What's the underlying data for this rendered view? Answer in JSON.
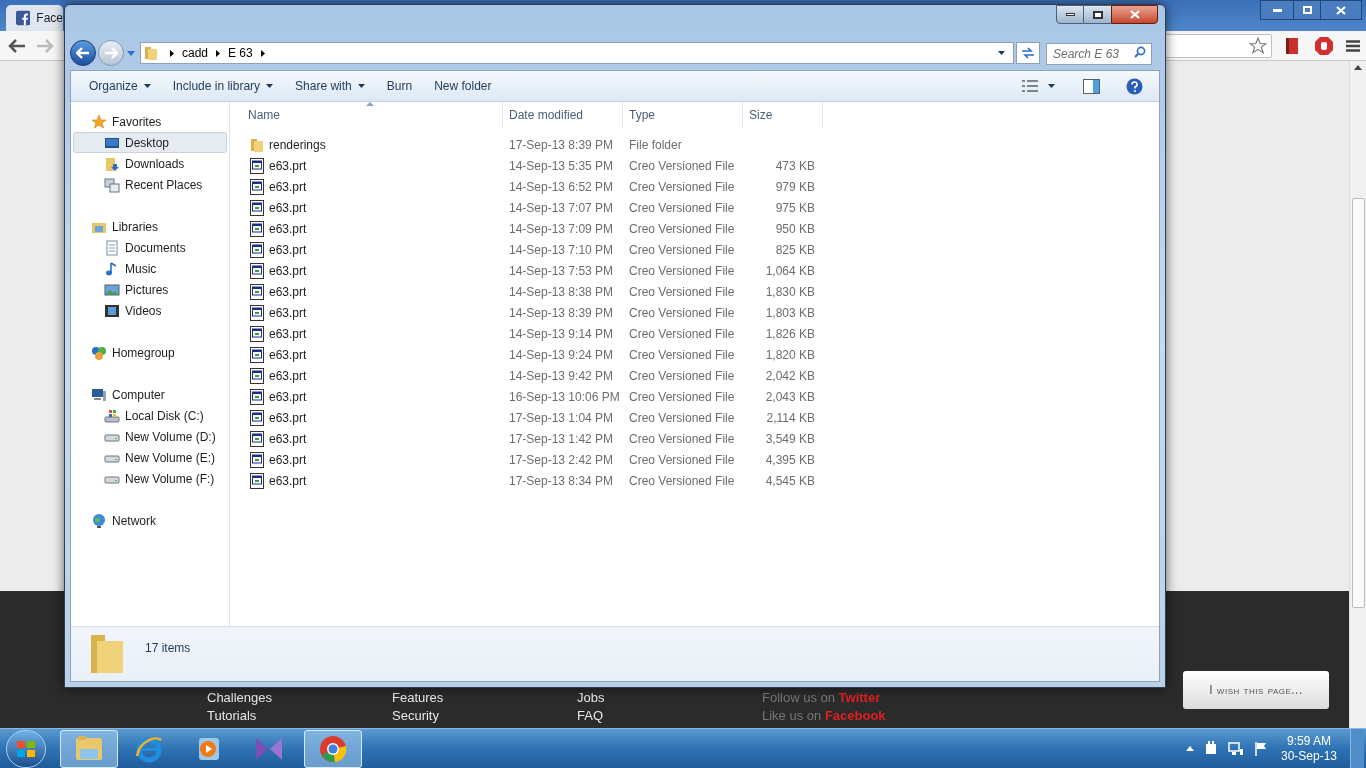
{
  "browser": {
    "tabs": [
      {
        "title": "Face",
        "selected": false
      }
    ],
    "footer": {
      "links": [
        [
          "Challenges",
          "Tutorials"
        ],
        [
          "Features",
          "Security"
        ],
        [
          "Jobs",
          "FAQ"
        ]
      ],
      "social": [
        "Follow us on **Twitter**",
        "Like us on **Facebook**"
      ],
      "feedback_button": "I wish this page..."
    }
  },
  "explorer": {
    "breadcrumb": [
      "cadd",
      "E 63"
    ],
    "search": {
      "placeholder": "Search E 63"
    },
    "toolbar": [
      {
        "label": "Organize",
        "dropdown": true
      },
      {
        "label": "Include in library",
        "dropdown": true
      },
      {
        "label": "Share with",
        "dropdown": true
      },
      {
        "label": "Burn",
        "dropdown": false
      },
      {
        "label": "New folder",
        "dropdown": false
      }
    ],
    "nav": [
      {
        "label": "Favorites",
        "kind": "star",
        "children": [
          {
            "label": "Desktop",
            "kind": "desktop",
            "selected": true
          },
          {
            "label": "Downloads",
            "kind": "downloads",
            "selected": false
          },
          {
            "label": "Recent Places",
            "kind": "recent",
            "selected": false
          }
        ]
      },
      {
        "label": "Libraries",
        "kind": "library",
        "children": [
          {
            "label": "Documents",
            "kind": "document",
            "selected": false
          },
          {
            "label": "Music",
            "kind": "music",
            "selected": false
          },
          {
            "label": "Pictures",
            "kind": "pictures",
            "selected": false
          },
          {
            "label": "Videos",
            "kind": "videos",
            "selected": false
          }
        ]
      },
      {
        "label": "Homegroup",
        "kind": "homegroup"
      },
      {
        "label": "Computer",
        "kind": "computer",
        "children": [
          {
            "label": "Local Disk (C:)",
            "kind": "disk",
            "selected": false
          },
          {
            "label": "New Volume (D:)",
            "kind": "drive",
            "selected": false
          },
          {
            "label": "New Volume (E:)",
            "kind": "drive",
            "selected": false
          },
          {
            "label": "New Volume (F:)",
            "kind": "drive",
            "selected": false
          }
        ]
      },
      {
        "label": "Network",
        "kind": "network"
      }
    ],
    "columns": [
      {
        "label": "Name",
        "sorted": true
      },
      {
        "label": "Date modified",
        "sorted": false
      },
      {
        "label": "Type",
        "sorted": false
      },
      {
        "label": "Size",
        "sorted": false
      }
    ],
    "files": [
      {
        "kind": "folder",
        "name": "renderings",
        "date": "17-Sep-13 8:39 PM",
        "type": "File folder"
      },
      {
        "kind": "file",
        "name": "e63.prt",
        "date": "14-Sep-13 5:35 PM",
        "type": "Creo Versioned File",
        "size": "473 KB"
      },
      {
        "kind": "file",
        "name": "e63.prt",
        "date": "14-Sep-13 6:52 PM",
        "type": "Creo Versioned File",
        "size": "979 KB"
      },
      {
        "kind": "file",
        "name": "e63.prt",
        "date": "14-Sep-13 7:07 PM",
        "type": "Creo Versioned File",
        "size": "975 KB"
      },
      {
        "kind": "file",
        "name": "e63.prt",
        "date": "14-Sep-13 7:09 PM",
        "type": "Creo Versioned File",
        "size": "950 KB"
      },
      {
        "kind": "file",
        "name": "e63.prt",
        "date": "14-Sep-13 7:10 PM",
        "type": "Creo Versioned File",
        "size": "825 KB"
      },
      {
        "kind": "file",
        "name": "e63.prt",
        "date": "14-Sep-13 7:53 PM",
        "type": "Creo Versioned File",
        "size": "1,064 KB"
      },
      {
        "kind": "file",
        "name": "e63.prt",
        "date": "14-Sep-13 8:38 PM",
        "type": "Creo Versioned File",
        "size": "1,830 KB"
      },
      {
        "kind": "file",
        "name": "e63.prt",
        "date": "14-Sep-13 8:39 PM",
        "type": "Creo Versioned File",
        "size": "1,803 KB"
      },
      {
        "kind": "file",
        "name": "e63.prt",
        "date": "14-Sep-13 9:14 PM",
        "type": "Creo Versioned File",
        "size": "1,826 KB"
      },
      {
        "kind": "file",
        "name": "e63.prt",
        "date": "14-Sep-13 9:24 PM",
        "type": "Creo Versioned File",
        "size": "1,820 KB"
      },
      {
        "kind": "file",
        "name": "e63.prt",
        "date": "14-Sep-13 9:42 PM",
        "type": "Creo Versioned File",
        "size": "2,042 KB"
      },
      {
        "kind": "file",
        "name": "e63.prt",
        "date": "16-Sep-13 10:06 PM",
        "type": "Creo Versioned File",
        "size": "2,043 KB"
      },
      {
        "kind": "file",
        "name": "e63.prt",
        "date": "17-Sep-13 1:04 PM",
        "type": "Creo Versioned File",
        "size": "2,114 KB"
      },
      {
        "kind": "file",
        "name": "e63.prt",
        "date": "17-Sep-13 1:42 PM",
        "type": "Creo Versioned File",
        "size": "3,549 KB"
      },
      {
        "kind": "file",
        "name": "e63.prt",
        "date": "17-Sep-13 2:42 PM",
        "type": "Creo Versioned File",
        "size": "4,395 KB"
      },
      {
        "kind": "file",
        "name": "e63.prt",
        "date": "17-Sep-13 8:34 PM",
        "type": "Creo Versioned File",
        "size": "4,545 KB"
      }
    ],
    "status": "17 items"
  },
  "taskbar": {
    "apps": [
      {
        "kind": "explorer",
        "selected": true
      },
      {
        "kind": "ie",
        "selected": false
      },
      {
        "kind": "media",
        "selected": false
      },
      {
        "kind": "vs",
        "selected": false
      },
      {
        "kind": "chrome",
        "selected": true
      }
    ],
    "time": "9:59 AM",
    "date": "30-Sep-13"
  }
}
